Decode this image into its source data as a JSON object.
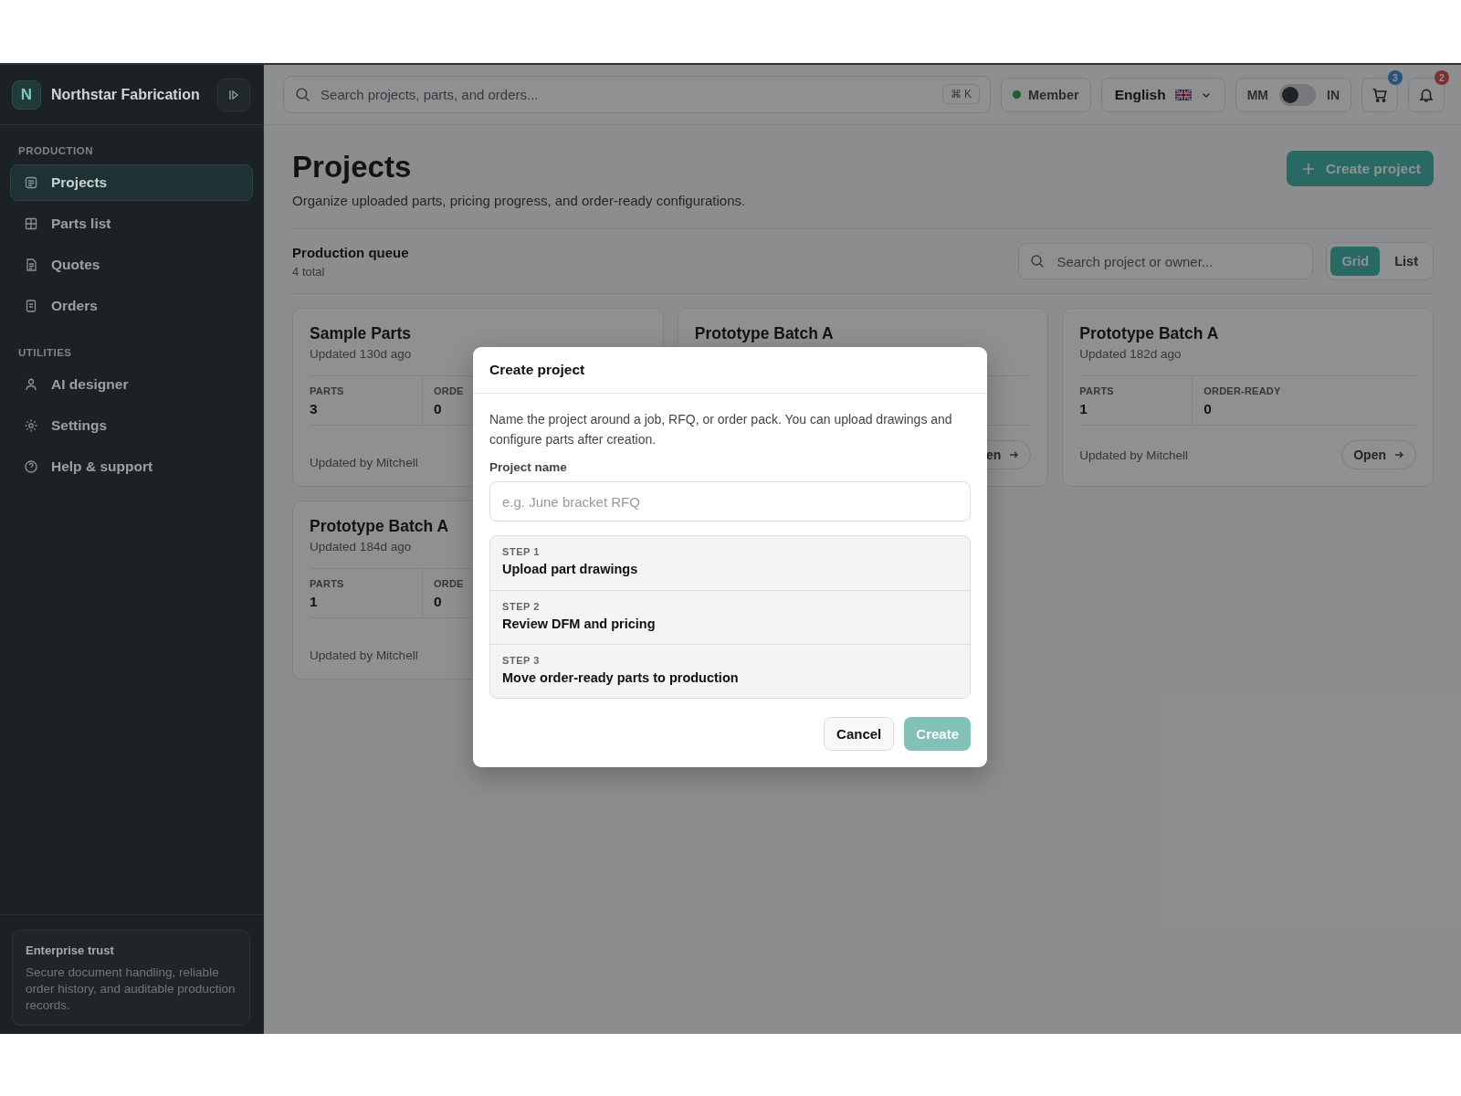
{
  "sidebar": {
    "brand": {
      "initial": "N",
      "name": "Northstar Fabrication"
    },
    "sections": [
      {
        "heading": "PRODUCTION",
        "items": [
          {
            "label": "Projects",
            "selected": true
          },
          {
            "label": "Parts list",
            "selected": false
          },
          {
            "label": "Quotes",
            "selected": false
          },
          {
            "label": "Orders",
            "selected": false
          }
        ]
      },
      {
        "heading": "UTILITIES",
        "items": [
          {
            "label": "AI designer",
            "selected": false
          },
          {
            "label": "Settings",
            "selected": false
          },
          {
            "label": "Help & support",
            "selected": false
          }
        ]
      }
    ],
    "trust_card": {
      "title": "Enterprise trust",
      "text": "Secure document handling, reliable order history, and auditable production records."
    }
  },
  "topbar": {
    "search": {
      "placeholder": "Search projects, parts, and orders...",
      "shortcut": "⌘ K"
    },
    "role": {
      "label": "Member"
    },
    "language": {
      "label": "English"
    },
    "units": {
      "left": "MM",
      "right": "IN",
      "on": false
    },
    "cart": {
      "count": "3"
    },
    "notifications": {
      "count": "2"
    }
  },
  "page": {
    "title": "Projects",
    "subtitle": "Organize uploaded parts, pricing progress, and order-ready configurations.",
    "create_button": "Create project",
    "queue": {
      "title": "Production queue",
      "count": "4 total"
    },
    "filter": {
      "placeholder": "Search project or owner..."
    },
    "view_toggle": [
      {
        "label": "Grid",
        "selected": true
      },
      {
        "label": "List",
        "selected": false
      }
    ],
    "projects": [
      {
        "title": "Sample Parts",
        "updated": "Updated 130d ago",
        "stats": [
          {
            "label": "PARTS",
            "value": "3"
          },
          {
            "label": "ORDE",
            "value": "0"
          }
        ],
        "footer": "Updated by Mitchell"
      },
      {
        "title": "Prototype Batch A",
        "open": "en"
      },
      {
        "title": "Prototype Batch A",
        "updated": "Updated 182d ago",
        "stats": [
          {
            "label": "PARTS",
            "value": "1"
          },
          {
            "label": "ORDER-READY",
            "value": "0"
          }
        ],
        "footer": "Updated by Mitchell",
        "open": "Open"
      },
      {
        "title": "Prototype Batch A",
        "updated": "Updated 184d ago",
        "stats": [
          {
            "label": "PARTS",
            "value": "1"
          },
          {
            "label": "ORDE",
            "value": "0"
          }
        ],
        "footer": "Updated by Mitchell"
      }
    ]
  },
  "dialog": {
    "title": "Create project",
    "description": "Name the project around a job, RFQ, or order pack. You can upload drawings and configure parts after creation.",
    "field_label": "Project name",
    "placeholder": "e.g. June bracket RFQ",
    "steps": [
      {
        "step": "STEP 1",
        "title": "Upload part drawings"
      },
      {
        "step": "STEP 2",
        "title": "Review DFM and pricing"
      },
      {
        "step": "STEP 3",
        "title": "Move order-ready parts to production"
      }
    ],
    "cancel": "Cancel",
    "create": {
      "label": "Create",
      "disabled": true
    }
  }
}
